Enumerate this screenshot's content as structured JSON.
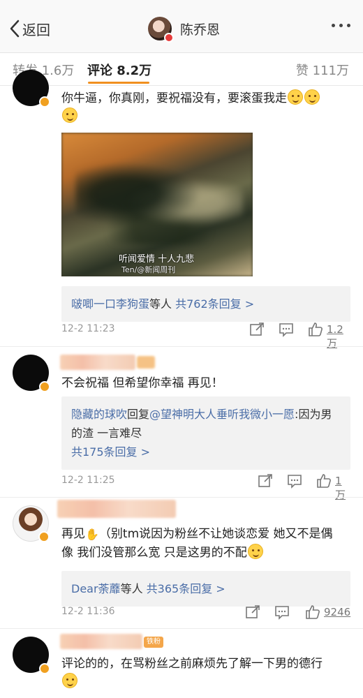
{
  "nav": {
    "back_label": "返回",
    "user_name": "陈乔恩"
  },
  "tabs": {
    "repost": "转发 1.6万",
    "comments": "评论 8.2万",
    "likes": "赞 111万",
    "active": "comments",
    "accent": "#f09020"
  },
  "comments": [
    {
      "text": "你牛逼，你真刚，要祝福没有，要滚蛋我走",
      "gif_caption": "听闻爱情 十人九悲",
      "gif_watermark": "Ten/@新闻周刊",
      "reply_summary_users": "啵唧一口李狗蛋",
      "reply_summary_suffix": "等人",
      "reply_count": "共762条回复 >",
      "time": "12-2 11:23",
      "likes": "1.2万"
    },
    {
      "text": "不会祝福 但希望你幸福 再见！",
      "reply_user": "隐藏的球吹",
      "reply_mid": "回复",
      "reply_target": "@望神明大人垂听我微小一愿",
      "reply_text": ":因为男的渣 一言难尽",
      "reply_count": "共175条回复 >",
      "time": "12-2 11:25",
      "likes": "1万"
    },
    {
      "text_a": "再见",
      "text_b": "（别tm说因为粉丝不让她谈恋爱 她又不是偶像 我们没管那么宽 只是这男的不配",
      "reply_summary_users": "Dear荼蘼",
      "reply_summary_suffix": "等人",
      "reply_count": "共365条回复 >",
      "time": "12-2 11:36",
      "likes": "9246"
    },
    {
      "badge": "铁粉",
      "text": "评论的的，在骂粉丝之前麻烦先了解一下男的德行"
    }
  ],
  "icons": {
    "back": "chevron-left-icon",
    "more": "more-dots-icon",
    "share": "share-icon",
    "reply": "comment-icon",
    "like": "thumbs-up-icon",
    "verified": "verified-badge-icon",
    "emoji": "smile-emoji-icon"
  },
  "colors": {
    "link": "#4a6da7",
    "verified_gold": "#f0a020",
    "verified_red": "#e63c3c"
  }
}
